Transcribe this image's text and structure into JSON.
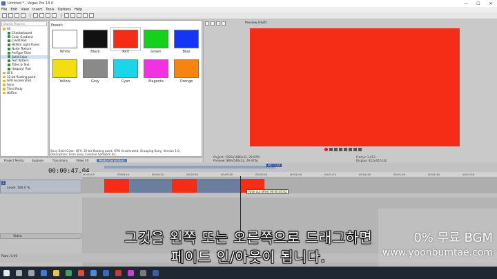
{
  "window": {
    "title": "Untitled * - Vegas Pro 13.0",
    "min": "—",
    "max": "☐",
    "close": "✕"
  },
  "menu": [
    "File",
    "Edit",
    "View",
    "Insert",
    "Tools",
    "Options",
    "Help"
  ],
  "tree": {
    "search_placeholder": "Search Plug-ins",
    "items": [
      {
        "label": "All",
        "kind": "folder",
        "selected": false
      },
      {
        "label": "Checkerboard",
        "kind": "plugin",
        "selected": false
      },
      {
        "label": "Color Gradient",
        "kind": "plugin",
        "selected": false
      },
      {
        "label": "Credit Roll",
        "kind": "plugin",
        "selected": false
      },
      {
        "label": "HitFilm Light Flares",
        "kind": "plugin",
        "selected": false
      },
      {
        "label": "Noise Texture",
        "kind": "plugin",
        "selected": false
      },
      {
        "label": "ProType Titler",
        "kind": "plugin",
        "selected": false
      },
      {
        "label": "Solid Color",
        "kind": "plugin",
        "selected": true
      },
      {
        "label": "Test Pattern",
        "kind": "plugin",
        "selected": false
      },
      {
        "label": "Titles & Text",
        "kind": "plugin",
        "selected": false
      },
      {
        "label": "(Legacy) Text",
        "kind": "plugin",
        "selected": false
      },
      {
        "label": "OFX",
        "kind": "folder",
        "selected": false
      },
      {
        "label": "32-bit floating point",
        "kind": "folder",
        "selected": false
      },
      {
        "label": "GPU Accelerated",
        "kind": "folder",
        "selected": false
      },
      {
        "label": "Sony",
        "kind": "folder",
        "selected": false
      },
      {
        "label": "Third Party",
        "kind": "folder",
        "selected": false
      },
      {
        "label": "HitFilm",
        "kind": "folder",
        "selected": false
      }
    ]
  },
  "presets": {
    "label": "Preset:",
    "swatches": [
      {
        "name": "White",
        "color": "#ffffff"
      },
      {
        "name": "Black",
        "color": "#111111"
      },
      {
        "name": "Red",
        "color": "#f52c16"
      },
      {
        "name": "Green",
        "color": "#14d21a"
      },
      {
        "name": "Blue",
        "color": "#1535f5"
      },
      {
        "name": "Yellow",
        "color": "#f2de12"
      },
      {
        "name": "Gray",
        "color": "#8a8a8a"
      },
      {
        "name": "Cyan",
        "color": "#1ad6e8"
      },
      {
        "name": "Magenta",
        "color": "#f232e0"
      },
      {
        "name": "Orange",
        "color": "#f88410"
      }
    ],
    "info_line1": "Sony Solid Color: OFX, 32-bit floating point, GPU Accelerated, Grouping Sony, Version 1.0",
    "info_line2": "Description: From Sony Creative Software Inc."
  },
  "tabs": [
    "Project Media",
    "Explorer",
    "Transitions",
    "Video FX",
    "Media Generators"
  ],
  "preview": {
    "label": "Preview (Half)",
    "project": "Project: 1920x1080x32, 29.970i",
    "preview_res": "Preview: 960x540x32, 29.970p",
    "frame": "Frame: 1,413",
    "display": "Display: 812x457x32"
  },
  "timeline": {
    "timecode": "00:00:47.04",
    "level": "Level: 100.0 %",
    "track_number": "1",
    "video_track": "Video",
    "ruler": [
      "00:00:00",
      "00:00:10",
      "00:00:20",
      "00:00:30",
      "00:00:40",
      "00:00:50",
      "00:01:00",
      "00:01:10",
      "00:01:20",
      "00:01:30",
      "00:01:40",
      "00:01:50"
    ],
    "fade_tooltip": "Fade out offset 00:00:05;02",
    "marker_label": "00:17;26",
    "rate": "Rate: 0.00"
  },
  "subtitle": {
    "line1": "그것을 왼쪽 또는 오른쪽으로 드래그하면",
    "line2": "페이드 인/아웃이 됩니다."
  },
  "watermark": {
    "line1": "0% 무료 BGM",
    "line2": "www.yoonbumtae.com"
  }
}
